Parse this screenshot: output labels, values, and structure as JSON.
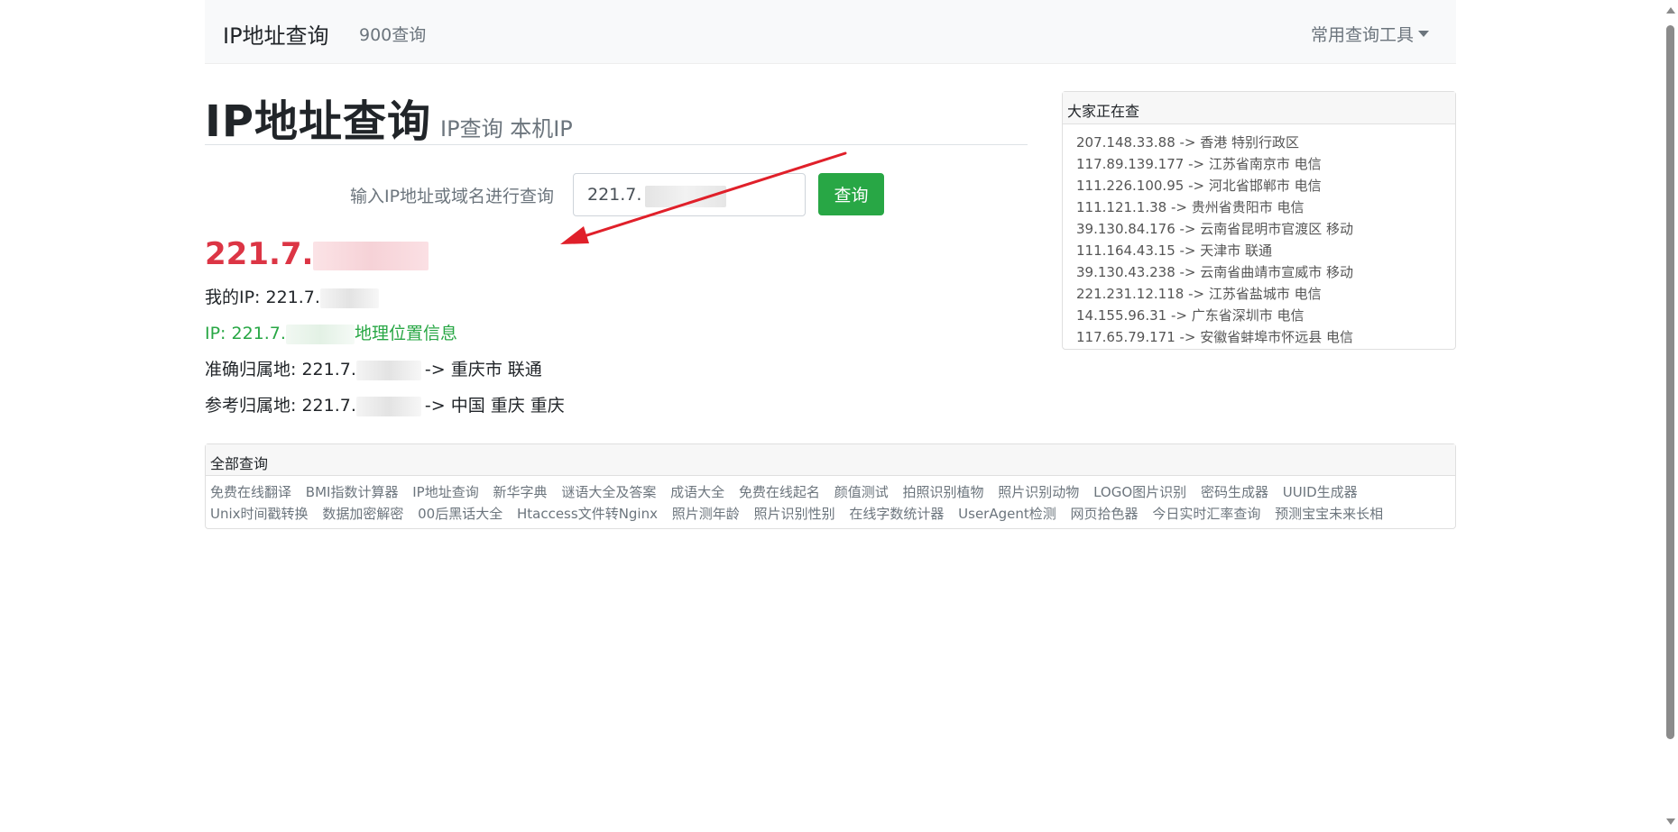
{
  "navbar": {
    "brand": "IP地址查询",
    "link": "900查询",
    "dropdown": "常用查询工具"
  },
  "header": {
    "title": "IP地址查询",
    "subtitle": "IP查询 本机IP"
  },
  "search": {
    "label": "输入IP地址或域名进行查询",
    "value": "221.7.",
    "button": "查询"
  },
  "result": {
    "ip_prefix": "221.7.",
    "my_ip_label": "我的IP: 221.7.",
    "geo_prefix": "IP: 221.7.",
    "geo_link": "地理位置信息",
    "exact_label": "准确归属地: 221.7.",
    "exact_value": "-> 重庆市 联通",
    "ref_label": "参考归属地: 221.7.",
    "ref_value": "-> 中国 重庆 重庆"
  },
  "recent": {
    "title": "大家正在查",
    "items": [
      {
        "ip": "207.148.33.88",
        "loc": "香港 特别行政区"
      },
      {
        "ip": "117.89.139.177",
        "loc": "江苏省南京市 电信"
      },
      {
        "ip": "111.226.100.95",
        "loc": "河北省邯郸市 电信"
      },
      {
        "ip": "111.121.1.38",
        "loc": "贵州省贵阳市 电信"
      },
      {
        "ip": "39.130.84.176",
        "loc": "云南省昆明市官渡区 移动"
      },
      {
        "ip": "111.164.43.15",
        "loc": "天津市 联通"
      },
      {
        "ip": "39.130.43.238",
        "loc": "云南省曲靖市宣威市 移动"
      },
      {
        "ip": "221.231.12.118",
        "loc": "江苏省盐城市 电信"
      },
      {
        "ip": "14.155.96.31",
        "loc": "广东省深圳市 电信"
      },
      {
        "ip": "117.65.79.171",
        "loc": "安徽省蚌埠市怀远县 电信"
      }
    ]
  },
  "tools": {
    "title": "全部查询",
    "links": [
      "免费在线翻译",
      "BMI指数计算器",
      "IP地址查询",
      "新华字典",
      "谜语大全及答案",
      "成语大全",
      "免费在线起名",
      "颜值测试",
      "拍照识别植物",
      "照片识别动物",
      "LOGO图片识别",
      "密码生成器",
      "UUID生成器",
      "Unix时间戳转换",
      "数据加密解密",
      "00后黑话大全",
      "Htaccess文件转Nginx",
      "照片测年龄",
      "照片识别性别",
      "在线字数统计器",
      "UserAgent检测",
      "网页拾色器",
      "今日实时汇率查询",
      "预测宝宝未来长相"
    ]
  },
  "colors": {
    "result_red": "#dc3545",
    "success_green": "#28a745",
    "muted": "#6c757d",
    "arrow": "#e0202a"
  }
}
